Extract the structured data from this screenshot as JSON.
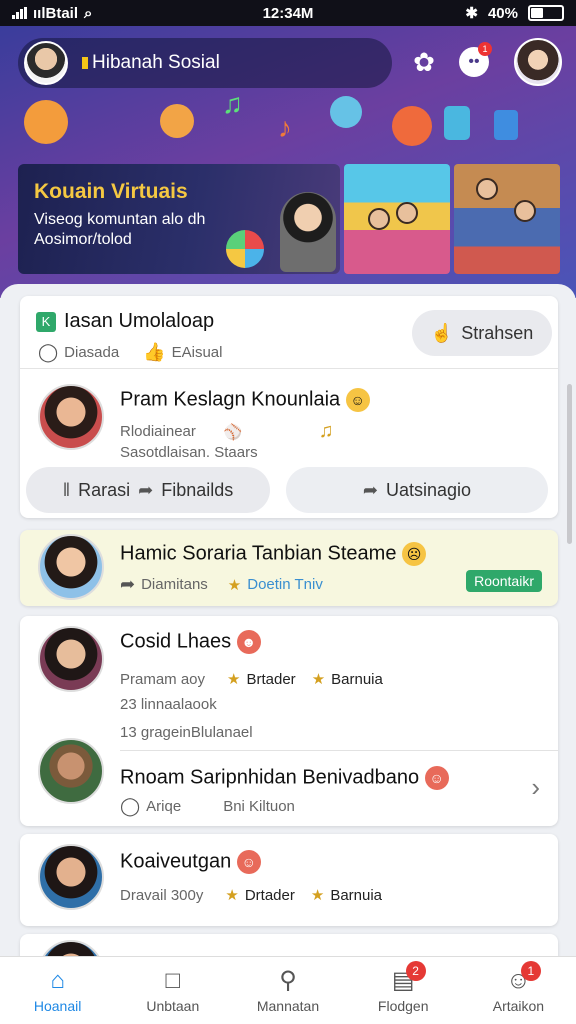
{
  "status_bar": {
    "carrier": "ıılBtail",
    "time": "12:34M",
    "battery": "40%",
    "battery_level": 0.4
  },
  "header": {
    "app_title": "Hibanah Sosial",
    "notification_count": "1"
  },
  "banner": {
    "title": "Kouain Virtuais",
    "subtitle": "Viseog komuntan alo dh Aosimor/tolod"
  },
  "section": {
    "title": "Iasan Umolaloap",
    "meta1": "Diasada",
    "meta2": "EAisual",
    "action": "Strahsen"
  },
  "feed": [
    {
      "name": "Pram Keslagn Knounlaia",
      "line1": "Rlodiainear",
      "line2": "Sasotdlaisan. Staars",
      "btn_left": "Rarasi",
      "btn_mid": "Fibnailds",
      "btn_right": "Uatsinagio"
    },
    {
      "name": "Hamic Soraria Tanbian Steame",
      "meta1": "Diamitans",
      "meta2": "Doetin Tniv",
      "tag": "Roontaikr"
    },
    {
      "name": "Cosid Lhaes",
      "meta1": "Pramam aoy",
      "meta2": "Brtader",
      "meta3": "Barnuia",
      "line2": "23 linnaalaook",
      "line3": "13 grageinBlulanael"
    },
    {
      "name": "Rnoam Saripnhidan Benivadbano",
      "meta1": "Ariqe",
      "meta2": "Bni Kiltuon"
    },
    {
      "name": "Koaiveutgan",
      "meta1": "Dravail 300y",
      "meta2": "Drtader",
      "meta3": "Barnuia"
    }
  ],
  "bottom_nav": [
    {
      "label": "Hoanail",
      "icon": "home-icon",
      "active": true
    },
    {
      "label": "Unbtaan",
      "icon": "chat-icon"
    },
    {
      "label": "Mannatan",
      "icon": "search-icon"
    },
    {
      "label": "Flodgen",
      "icon": "notes-icon",
      "badge": "2"
    },
    {
      "label": "Artaikon",
      "icon": "profile-icon",
      "badge": "1"
    }
  ],
  "colors": {
    "accent": "#1e88e5",
    "highlight_row": "#f7f7df",
    "tag_green": "#2fa86a"
  }
}
